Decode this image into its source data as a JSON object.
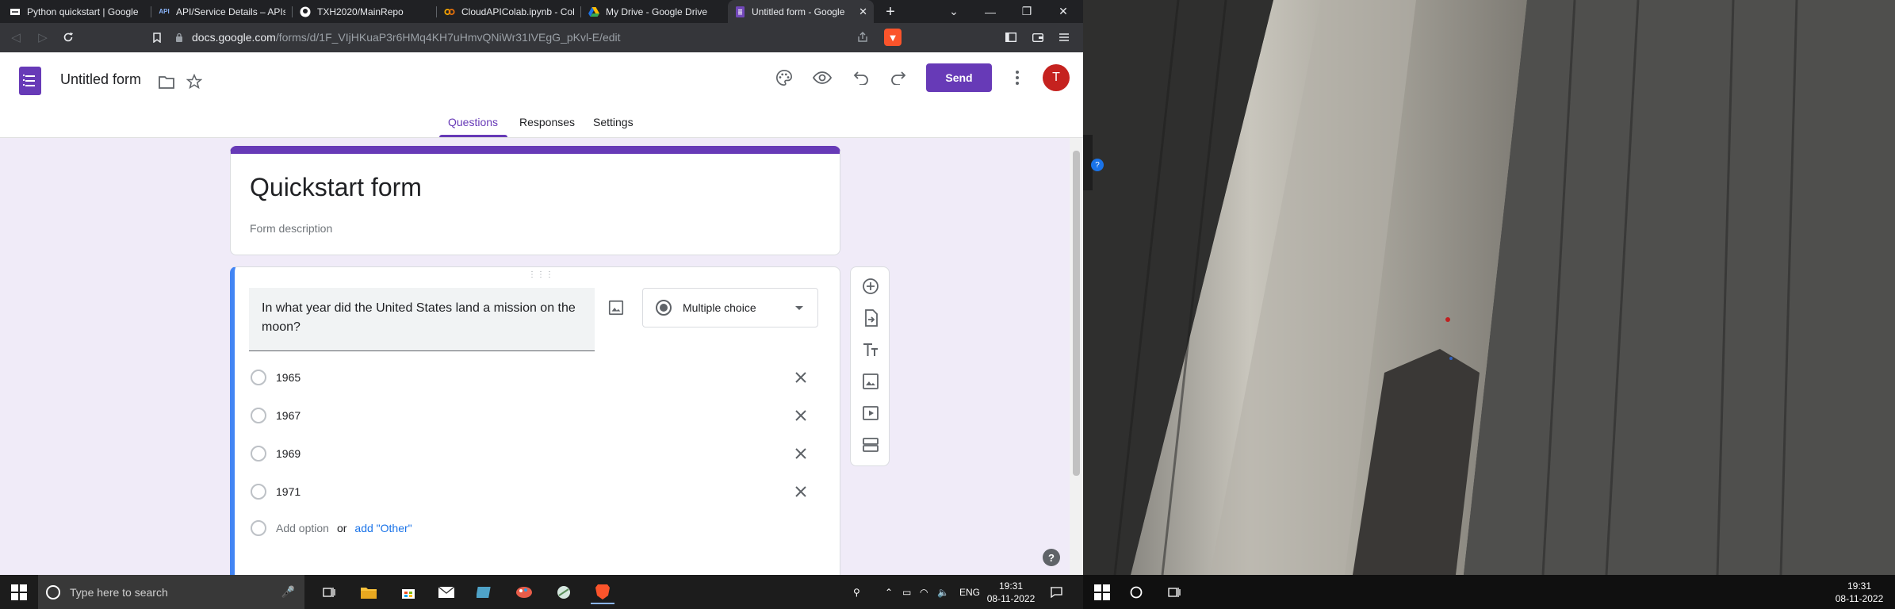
{
  "browser": {
    "tabs": [
      {
        "title": "Python quickstart  |  Google",
        "favicon": "google-dev",
        "active": false
      },
      {
        "title": "API/Service Details – APIs &",
        "favicon": "api",
        "active": false
      },
      {
        "title": "TXH2020/MainRepo",
        "favicon": "github",
        "active": false
      },
      {
        "title": "CloudAPIColab.ipynb - Col",
        "favicon": "colab",
        "active": false
      },
      {
        "title": "My Drive - Google Drive",
        "favicon": "drive",
        "active": false
      },
      {
        "title": "Untitled form - Google",
        "favicon": "forms",
        "active": true
      }
    ],
    "url_host": "docs.google.com",
    "url_path": "/forms/d/1F_VIjHKuaP3r6HMq4KH7uHmvQNiWr31IVEgG_pKvl-E/edit",
    "api_badge": "API"
  },
  "header": {
    "doc_title": "Untitled form",
    "send_label": "Send",
    "avatar_letter": "T",
    "tabs": {
      "questions": "Questions",
      "responses": "Responses",
      "settings": "Settings"
    }
  },
  "form": {
    "title": "Quickstart form",
    "description_placeholder": "Form description",
    "question": {
      "text": "In what year did the United States land a mission on the moon?",
      "type": "Multiple choice",
      "options": [
        "1965",
        "1967",
        "1969",
        "1971"
      ],
      "add_option": "Add option",
      "or": "or",
      "add_other": "add \"Other\""
    }
  },
  "help_label": "?",
  "taskbar": {
    "search_placeholder": "Type here to search",
    "lang": "ENG",
    "time": "19:31",
    "date": "08-11-2022"
  },
  "right_taskbar": {
    "time": "19:31",
    "date": "08-11-2022"
  },
  "colors": {
    "forms_purple": "#673ab7",
    "question_accent": "#4285f4",
    "link_blue": "#1a73e8",
    "background": "#f0ebf8"
  }
}
